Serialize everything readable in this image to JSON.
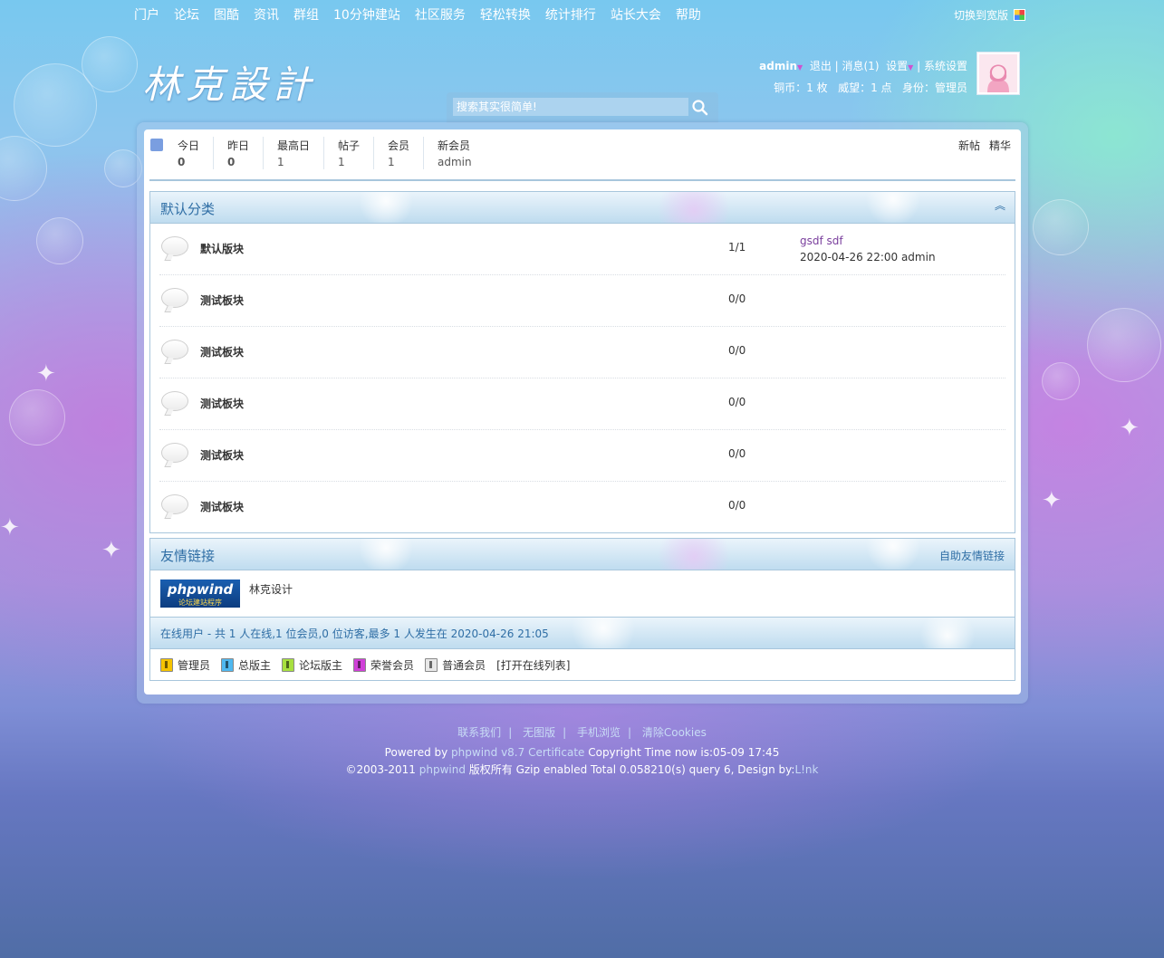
{
  "topnav": {
    "items": [
      "门户",
      "论坛",
      "图酷",
      "资讯",
      "群组",
      "10分钟建站",
      "社区服务",
      "轻松转换",
      "统计排行",
      "站长大会",
      "帮助"
    ],
    "switch_wide": "切换到宽版"
  },
  "header": {
    "logo_text": "林克設計",
    "search_placeholder": "搜索其实很简单!",
    "user": {
      "name": "admin",
      "logout": "退出",
      "messages": "消息(1)",
      "settings": "设置",
      "system_settings": "系统设置",
      "copper": "铜币：1 枚",
      "prestige": "威望：1 点",
      "role": "身份：管理员"
    }
  },
  "stats": {
    "today_label": "今日",
    "today": "0",
    "yesterday_label": "昨日",
    "yesterday": "0",
    "max_label": "最高日",
    "max": "1",
    "posts_label": "帖子",
    "posts": "1",
    "members_label": "会员",
    "members": "1",
    "newmember_label": "新会员",
    "newmember": "admin",
    "new_posts": "新帖",
    "digest": "精华"
  },
  "category": {
    "title": "默认分类",
    "forums": [
      {
        "name": "默认版块",
        "count": "1/1",
        "last_title": "gsdf sdf",
        "last_meta": "2020-04-26 22:00 admin"
      },
      {
        "name": "测试板块",
        "count": "0/0",
        "last_title": "",
        "last_meta": ""
      },
      {
        "name": "测试板块",
        "count": "0/0",
        "last_title": "",
        "last_meta": ""
      },
      {
        "name": "测试板块",
        "count": "0/0",
        "last_title": "",
        "last_meta": ""
      },
      {
        "name": "测试板块",
        "count": "0/0",
        "last_title": "",
        "last_meta": ""
      },
      {
        "name": "测试板块",
        "count": "0/0",
        "last_title": "",
        "last_meta": ""
      }
    ]
  },
  "links": {
    "title": "友情链接",
    "self_link": "自助友情链接",
    "logo_text": "phpwind",
    "logo_sub": "论坛建站程序",
    "site_name": "林克设计"
  },
  "online": {
    "text": "在线用户 - 共 1 人在线,1 位会员,0 位访客,最多 1 人发生在 2020-04-26 21:05",
    "legend": [
      {
        "label": "管理员",
        "color": "#f5c400"
      },
      {
        "label": "总版主",
        "color": "#4fb8f0"
      },
      {
        "label": "论坛版主",
        "color": "#a8e040"
      },
      {
        "label": "荣誉会员",
        "color": "#d040d8"
      },
      {
        "label": "普通会员",
        "color": "#e8e8e8"
      }
    ],
    "open_list": "[打开在线列表]"
  },
  "footer": {
    "links": [
      "联系我们",
      "无图版",
      "手机浏览",
      "清除Cookies"
    ],
    "powered_pre": "Powered by ",
    "powered_link": "phpwind v8.7 Certificate",
    "powered_post": " Copyright Time now is:05-09 17:45",
    "copy_pre": "©2003-2011 ",
    "copy_link": "phpwind",
    "copy_post": " 版权所有 Gzip enabled Total 0.058210(s) query 6, Design by:",
    "design_link": "L!nk"
  }
}
